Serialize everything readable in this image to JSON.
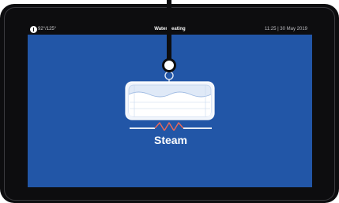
{
  "status": {
    "temperature": "92°/125°",
    "title": "Water heating",
    "datetime": "11:25 | 30 May 2019"
  },
  "tank": {
    "label": "Steam"
  },
  "icons": {
    "status": "temperature-gauge-icon",
    "tank": "water-tank-icon",
    "heater": "heating-element-icon",
    "valve": "valve-icon"
  },
  "colors": {
    "screen_background": "#2256a7",
    "bezel": "#0d0d0f",
    "heating_element": "#e8685a",
    "text": "#ffffff"
  }
}
